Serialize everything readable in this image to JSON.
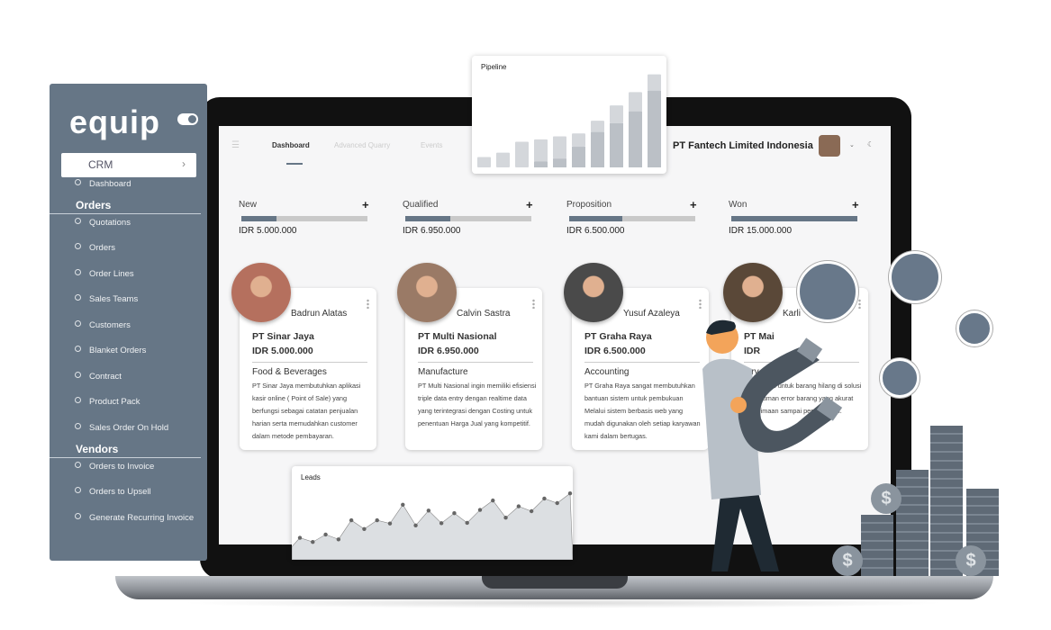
{
  "sidebar": {
    "logo": "equip",
    "module": "CRM",
    "items": [
      {
        "type": "item",
        "label": "Dashboard"
      },
      {
        "type": "head",
        "label": "Orders"
      },
      {
        "type": "item",
        "label": "Quotations"
      },
      {
        "type": "item",
        "label": "Orders"
      },
      {
        "type": "item",
        "label": "Order Lines"
      },
      {
        "type": "item",
        "label": "Sales Teams"
      },
      {
        "type": "item",
        "label": "Customers"
      },
      {
        "type": "item",
        "label": "Blanket Orders"
      },
      {
        "type": "item",
        "label": "Contract"
      },
      {
        "type": "item",
        "label": "Product Pack"
      },
      {
        "type": "item",
        "label": "Sales Order  On Hold"
      },
      {
        "type": "head",
        "label": "Vendors"
      },
      {
        "type": "item",
        "label": "Orders to Invoice"
      },
      {
        "type": "item",
        "label": "Orders to Upsell"
      },
      {
        "type": "item",
        "label": "Generate Recurring Invoice"
      }
    ]
  },
  "header": {
    "tabs": [
      "Dashboard",
      "Advanced Quarry",
      "Events"
    ],
    "active_tab": "Dashboard",
    "company": "PT Fantech Limited Indonesia"
  },
  "stages": [
    {
      "label": "New",
      "amount": "IDR 5.000.000",
      "progress": 0.28
    },
    {
      "label": "Qualified",
      "amount": "IDR 6.950.000",
      "progress": 0.36
    },
    {
      "label": "Proposition",
      "amount": "IDR 6.500.000",
      "progress": 0.42
    },
    {
      "label": "Won",
      "amount": "IDR 15.000.000",
      "progress": 1.0
    }
  ],
  "cards": [
    {
      "name": "Badrun Alatas",
      "company": "PT Sinar Jaya",
      "amount": "IDR 5.000.000",
      "category": "Food & Beverages",
      "description": "PT Sinar Jaya membutuhkan aplikasi kasir online ( Point of Sale) yang berfungsi sebagai catatan penjualan harian serta memudahkan customer dalam metode pembayaran.",
      "avatar_color": "#b5705e"
    },
    {
      "name": "Calvin Sastra",
      "company": "PT Multi Nasional",
      "amount": "IDR 6.950.000",
      "category": "Manufacture",
      "description": "PT Multi Nasional ingin memiliki efisiensi triple data entry dengan realtime data yang terintegrasi dengan Costing untuk penentuan Harga Jual yang kompetitif.",
      "avatar_color": "#9a7a66"
    },
    {
      "name": "Yusuf Azaleya",
      "company": "PT Graha Raya",
      "amount": "IDR 6.500.000",
      "category": "Accounting",
      "description": "PT Graha Raya sangat membutuhkan bantuan sistem untuk pembukuan Melalui sistem berbasis web yang mudah digunakan oleh setiap karyawan kami dalam bertugas.",
      "avatar_color": "#4a4a4a"
    },
    {
      "name": "Karli",
      "company": "PT Mai",
      "amount": "IDR",
      "category": "tory",
      "description": "masalahan untuk barang hilang di solusi agar human error barang yang akurat penerimaan sampai pengeluaran.",
      "avatar_color": "#5a4838"
    }
  ],
  "chart_data": [
    {
      "type": "bar",
      "title": "Pipeline",
      "stacked": true,
      "series": [
        {
          "values": [
            0,
            0,
            0,
            2,
            3,
            7,
            12,
            15,
            19,
            26
          ]
        },
        {
          "values": [
            3.5,
            5,
            8.7,
            7.5,
            7.5,
            4.5,
            3.8,
            6,
            6.5,
            5.5
          ]
        }
      ]
    },
    {
      "type": "area",
      "title": "Leads",
      "values": [
        68,
        55,
        78,
        63,
        122,
        95,
        122,
        112,
        170,
        106,
        152,
        113,
        144,
        114,
        154,
        183,
        130,
        165,
        150,
        189,
        175,
        205
      ]
    }
  ],
  "colors": {
    "accent": "#667686",
    "bar_track": "#c9c9c9",
    "sidebar": "#667686"
  }
}
